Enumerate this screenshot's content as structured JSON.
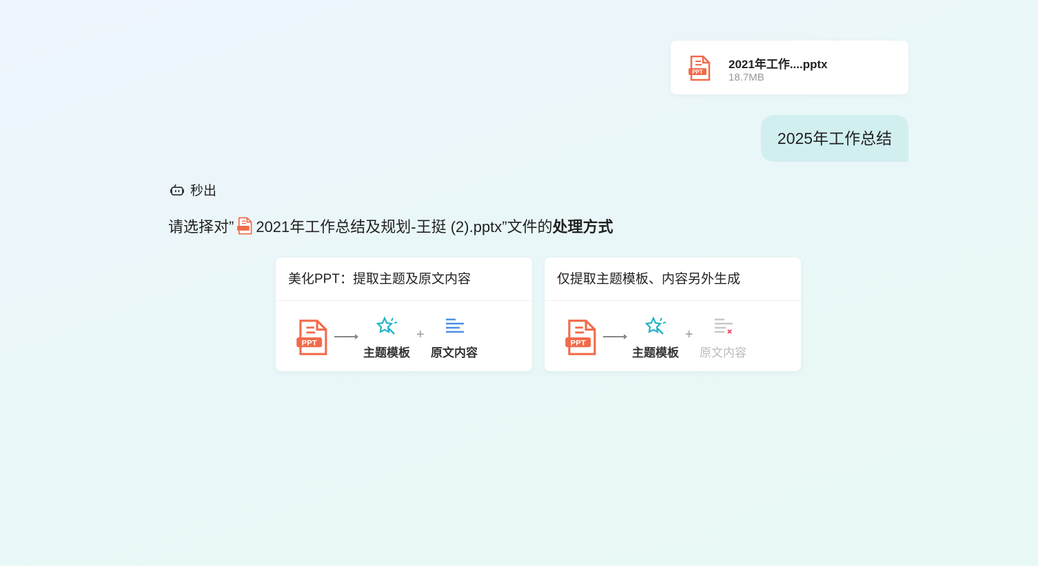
{
  "upload": {
    "file_name": "2021年工作....pptx",
    "file_size": "18.7MB",
    "icon": "ppt-file-icon"
  },
  "user_message": "2025年工作总结",
  "bot": {
    "name": "秒出",
    "icon": "robot-icon"
  },
  "prompt": {
    "prefix": "请选择对”",
    "file_name": "2021年工作总结及规划-王挺 (2).pptx",
    "suffix": "”文件的",
    "emphasis": "处理方式"
  },
  "options": [
    {
      "title": "美化PPT：提取主题及原文内容",
      "theme_label": "主题模板",
      "content_label": "原文内容",
      "content_included": true
    },
    {
      "title": "仅提取主题模板、内容另外生成",
      "theme_label": "主题模板",
      "content_label": "原文内容",
      "content_included": false
    }
  ],
  "colors": {
    "ppt": "#f26b4a",
    "theme": "#1fb2c4",
    "content": "#4a90e2",
    "excluded": "#f0506e"
  }
}
